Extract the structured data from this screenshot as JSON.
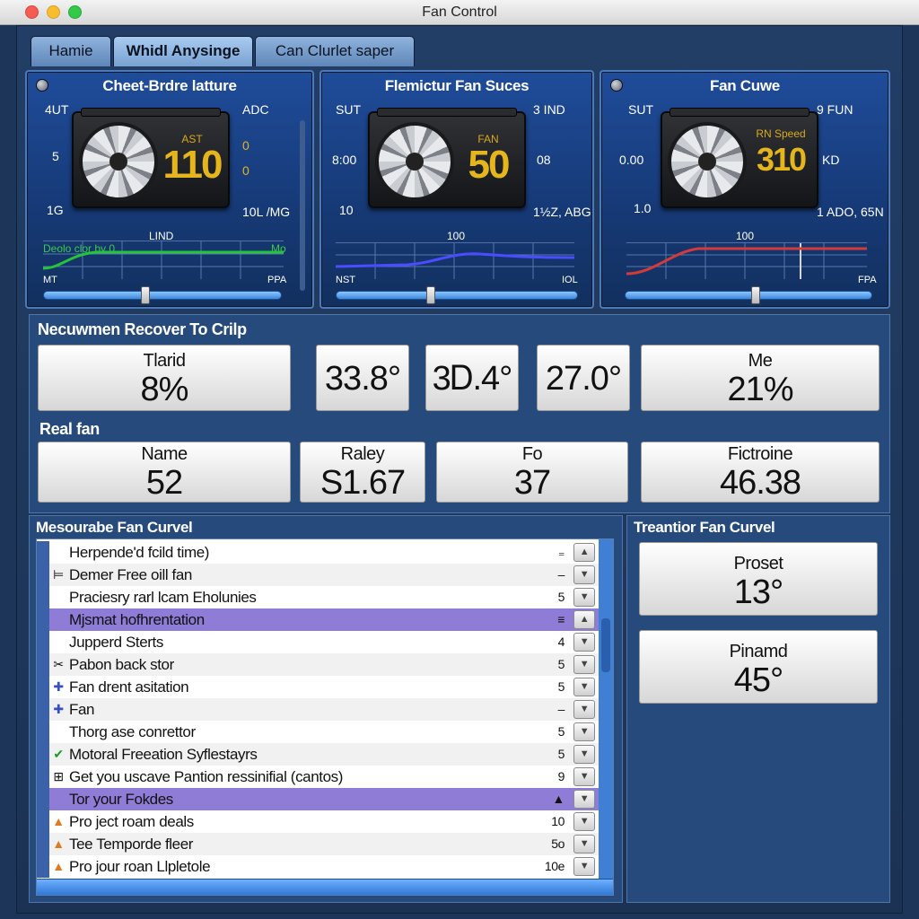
{
  "window": {
    "title": "Fan Control"
  },
  "tabs": [
    {
      "label": "Hamie"
    },
    {
      "label": "Whidl Anysinge"
    },
    {
      "label": "Can Clurlet saper"
    }
  ],
  "panels": [
    {
      "title": "Cheet-Brdre latture",
      "labels": {
        "tl": "4UT",
        "tr": "ADC",
        "ml": "5",
        "mr1": "0",
        "mr2": "0",
        "bl": "1G",
        "br": "10L /MG",
        "graph_top": "LIND",
        "graph_series": "Deolo clor by 0",
        "graph_right": "Mo",
        "axis_l": "MT",
        "axis_r": "PPA"
      },
      "readout": {
        "label": "AST",
        "value": "110"
      },
      "slider": 0.5
    },
    {
      "title": "Flemictur Fan Suces",
      "labels": {
        "tl": "SUT",
        "tr": "3 IND",
        "ml": "8:00",
        "mr1": "08",
        "bl": "10",
        "br": "1½Z, ABG",
        "graph_top": "100",
        "axis_l": "NST",
        "axis_r": "IOL"
      },
      "readout": {
        "label": "FAN",
        "value": "50"
      },
      "slider": 0.38
    },
    {
      "title": "Fan Cuwe",
      "labels": {
        "tl": "SUT",
        "tr": "9 FUN",
        "ml": "0.00",
        "mr1": "KD",
        "bl": "1.0",
        "br": "1 ADO, 65N",
        "graph_top": "100",
        "axis_r": "FPA"
      },
      "readout": {
        "label": "RN Speed",
        "value": "310"
      },
      "slider": 0.52
    }
  ],
  "recover": {
    "title": "Necuwmen Recover To Crilp",
    "cards": [
      {
        "label": "Tlarid",
        "value": "8%"
      },
      {
        "value": "33.8°"
      },
      {
        "value": "3Ꭰ.4°"
      },
      {
        "value": "27.0°"
      },
      {
        "label": "Me",
        "value": "21%"
      }
    ]
  },
  "realfan": {
    "title": "Real fan",
    "cards": [
      {
        "label": "Name",
        "value": "52"
      },
      {
        "label": "Raley",
        "value": "S1.67"
      },
      {
        "label": "Fo",
        "value": "37"
      },
      {
        "label": "Fictroine",
        "value": "46.38"
      }
    ]
  },
  "measure": {
    "title": "Mesourabe Fan Curvel",
    "rows": [
      {
        "text": "Herpende'd fcild time)",
        "num": "₌",
        "btn": "▲"
      },
      {
        "text": "Demer Free oill fan",
        "num": "–",
        "btn": "▼",
        "icon": "⊨"
      },
      {
        "text": "Praciesry rarl lcam Eholunies",
        "num": "5",
        "btn": "▼"
      },
      {
        "text": "Mjsmat hofhrentation",
        "num": "≡",
        "btn": "▲"
      },
      {
        "text": "Jupperd Sterts",
        "num": "4",
        "btn": "▼"
      },
      {
        "text": "Pabon back stor",
        "num": "5",
        "btn": "▼",
        "icon": "✂"
      },
      {
        "text": "Fan drent asitation",
        "num": "5",
        "btn": "▼",
        "icon": "✚"
      },
      {
        "text": "Fan",
        "num": "–",
        "btn": "▼",
        "icon": "✚"
      },
      {
        "text": "Thorg ase conrettor",
        "num": "5",
        "btn": "▼"
      },
      {
        "text": "Motoral Freeation Syflestayrs",
        "num": "5",
        "btn": "▼",
        "icon": "✔"
      },
      {
        "text": "Get you uscave Pantion ressinifial (cantos)",
        "num": "9",
        "btn": "▼",
        "icon": "⊞"
      },
      {
        "text": "Tor your Fokdes",
        "num": "▲",
        "btn": "▼"
      },
      {
        "text": "Pro ject roam deals",
        "num": "10",
        "btn": "▼",
        "icon": "▲"
      },
      {
        "text": "Tee Temporde fleer",
        "num": "5o",
        "btn": "▼",
        "icon": "▲"
      },
      {
        "text": "Pro jour roan Llpletole",
        "num": "10e",
        "btn": "▼",
        "icon": "▲"
      }
    ]
  },
  "transfer": {
    "title": "Treantior Fan Curvel",
    "cards": [
      {
        "label": "Proset",
        "value": "13°"
      },
      {
        "label": "Pinamd",
        "value": "45°"
      }
    ]
  },
  "colors": {
    "accent": "#3d89da",
    "selection": "#8f7cd6",
    "readout": "#e4b51c"
  }
}
